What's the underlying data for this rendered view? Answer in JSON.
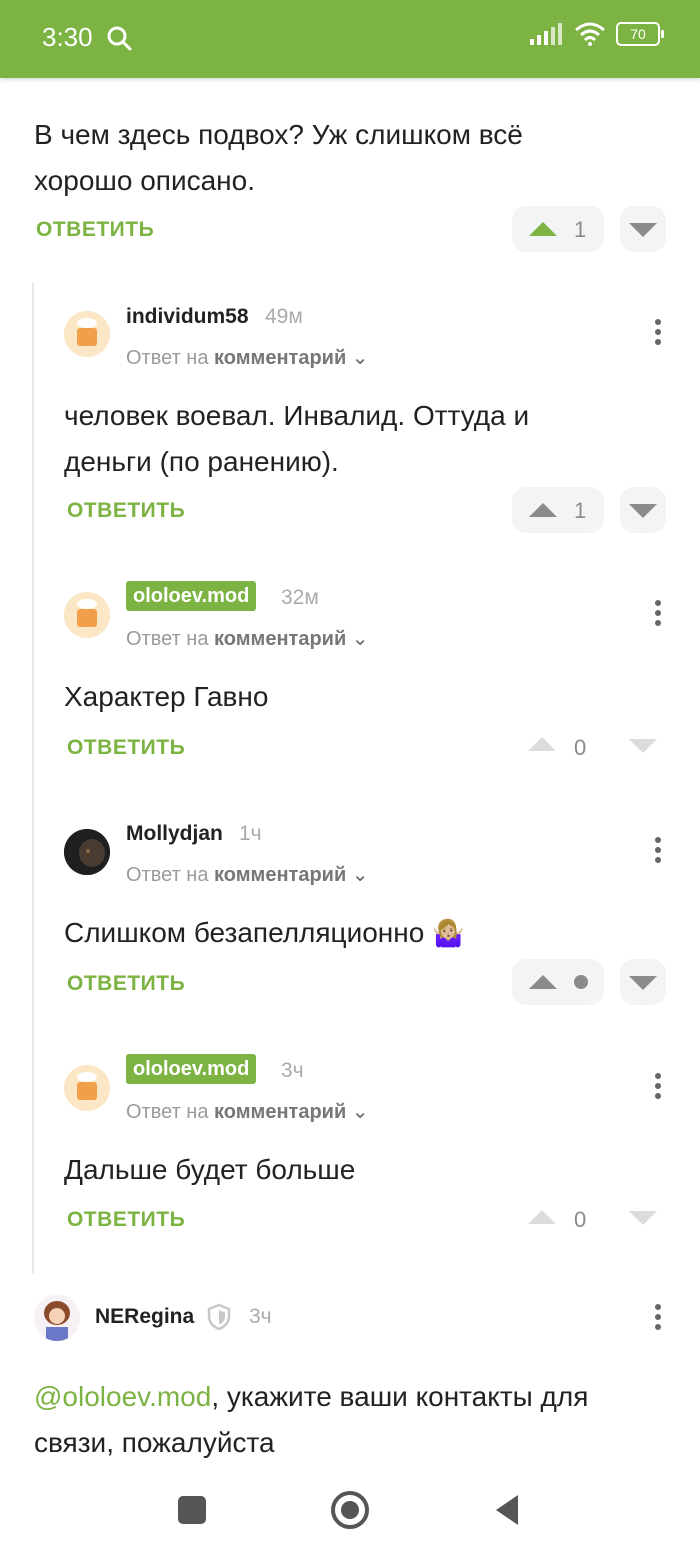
{
  "status": {
    "time": "3:30",
    "battery": "70"
  },
  "top_comment": {
    "text_line1": "В чем здесь подвох? Уж слишком всё",
    "text_line2": "хорошо описано.",
    "reply_label": "ОТВЕТИТЬ",
    "score": "1"
  },
  "comments": [
    {
      "user": "individum58",
      "ago": "49м",
      "reply_to_prefix": "Ответ на",
      "reply_to_target": "комментарий",
      "text_line1": "человек воевал. Инвалид. Оттуда и",
      "text_line2": "деньги (по ранению).",
      "reply_label": "ОТВЕТИТЬ",
      "score": "1"
    },
    {
      "user": "ololoev.mod",
      "ago": "32м",
      "reply_to_prefix": "Ответ на",
      "reply_to_target": "комментарий",
      "text_line1": "Характер Гавно",
      "reply_label": "ОТВЕТИТЬ",
      "score": "0"
    },
    {
      "user": "Mollydjan",
      "ago": "1ч",
      "reply_to_prefix": "Ответ на",
      "reply_to_target": "комментарий",
      "text_line1": "Слишком безапелляционно",
      "emoji": "🤷🏼‍♀️",
      "reply_label": "ОТВЕТИТЬ"
    },
    {
      "user": "ololoev.mod",
      "ago": "3ч",
      "reply_to_prefix": "Ответ на",
      "reply_to_target": "комментарий",
      "text_line1": "Дальше будет больше",
      "reply_label": "ОТВЕТИТЬ",
      "score": "0"
    }
  ],
  "bottom_comment": {
    "user": "NERegina",
    "ago": "3ч",
    "mention": "@ololoev.mod",
    "text_rest": ", укажите ваши контакты для",
    "text_line2": "связи, пожалуйста"
  },
  "colors": {
    "accent": "#7cb342",
    "text": "#222222",
    "muted": "#9a9a9a"
  }
}
